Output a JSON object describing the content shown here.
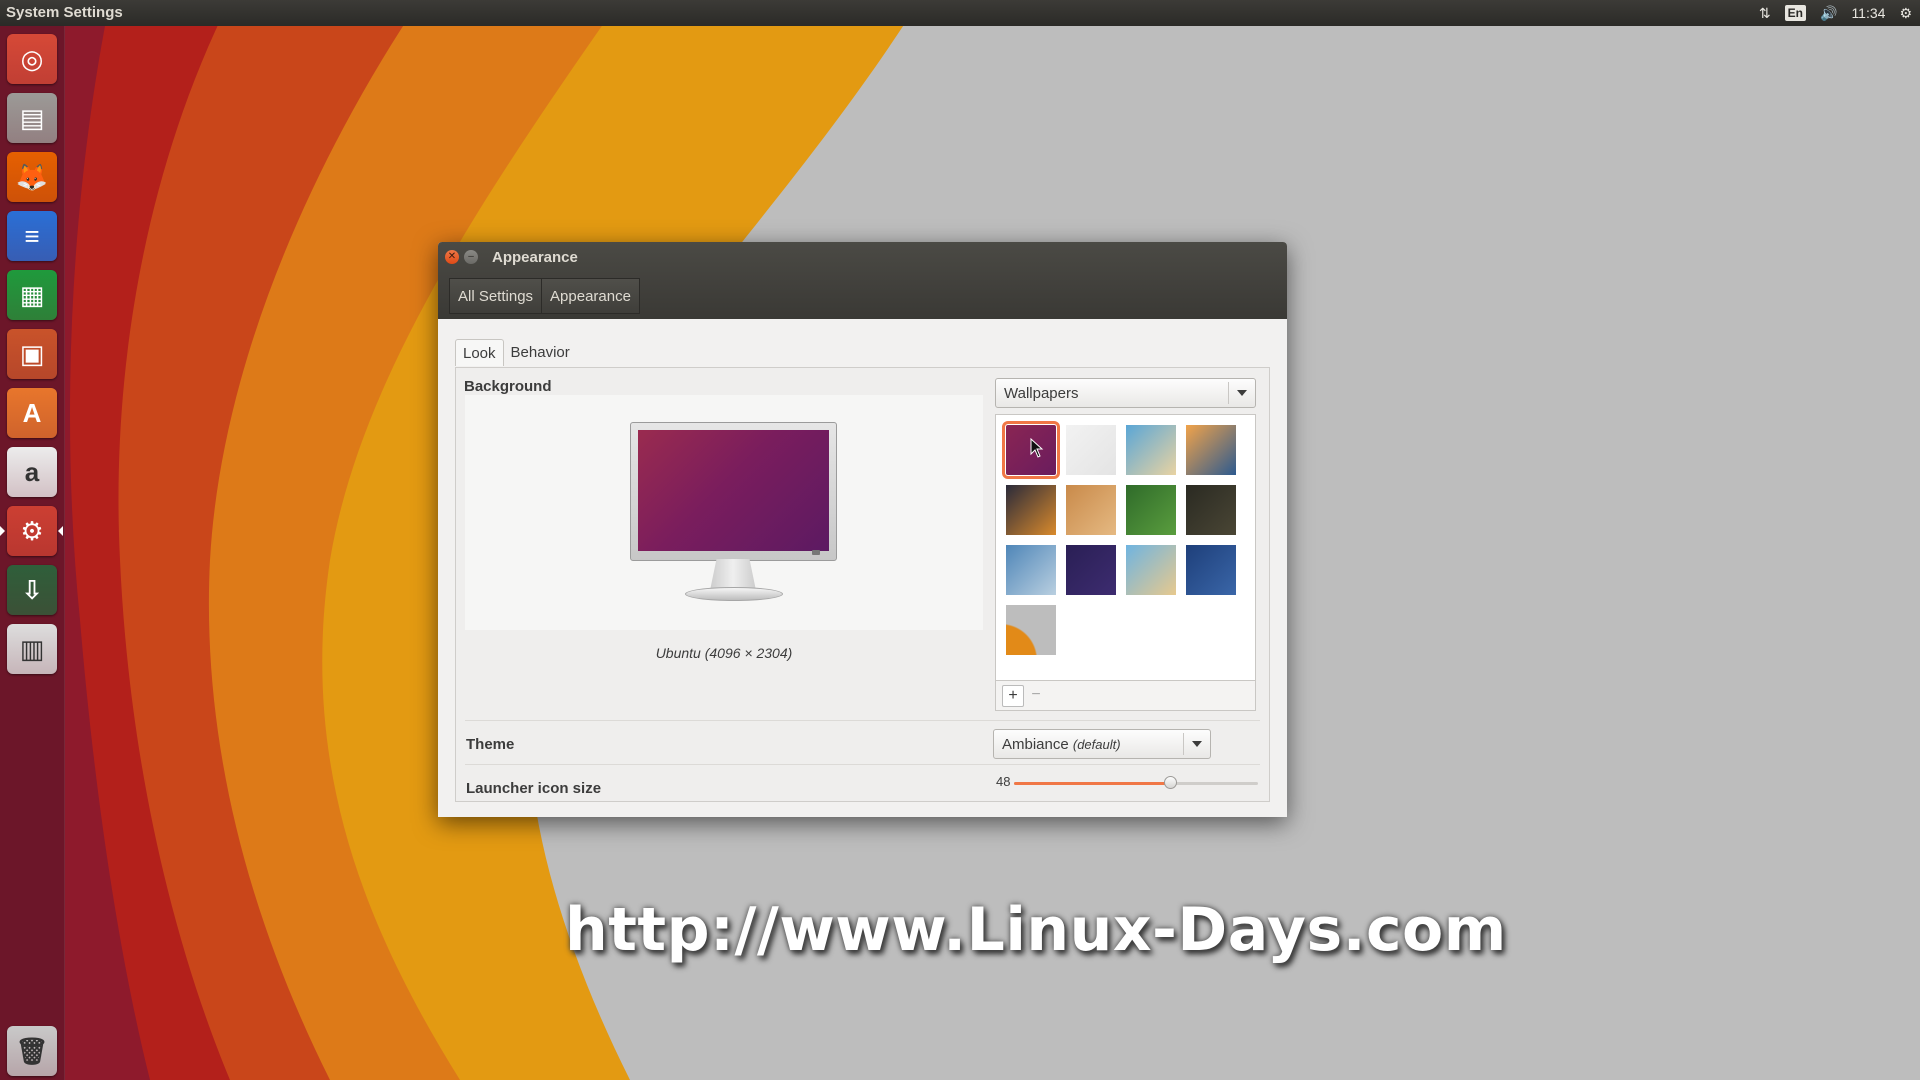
{
  "top_panel": {
    "app_title": "System Settings",
    "language": "En",
    "time": "11:34"
  },
  "launcher": {
    "items": [
      {
        "name": "Ubuntu Dash",
        "icon": "ubuntu-dash-icon",
        "color": "#d64937"
      },
      {
        "name": "Files",
        "icon": "files-icon",
        "color": "#9c9a97"
      },
      {
        "name": "Firefox",
        "icon": "firefox-icon",
        "color": "#e66000"
      },
      {
        "name": "LibreOffice Writer",
        "icon": "writer-icon",
        "color": "#2a6fd6"
      },
      {
        "name": "LibreOffice Calc",
        "icon": "calc-icon",
        "color": "#1f9a3c"
      },
      {
        "name": "LibreOffice Impress",
        "icon": "impress-icon",
        "color": "#c9532a"
      },
      {
        "name": "Ubuntu Software Center",
        "icon": "software-center-icon",
        "color": "#e8762c"
      },
      {
        "name": "Amazon",
        "icon": "amazon-icon",
        "color": "#ececec"
      },
      {
        "name": "System Settings",
        "icon": "system-settings-icon",
        "color": "#cc3f32"
      },
      {
        "name": "Terminal Installer",
        "icon": "installer-icon",
        "color": "#2f5f3a"
      },
      {
        "name": "Save",
        "icon": "floppy-icon",
        "color": "#dddddd"
      },
      {
        "name": "Trash",
        "icon": "trash-icon",
        "color": "#c9c9c9"
      }
    ]
  },
  "window": {
    "title": "Appearance",
    "breadcrumb": [
      "All Settings",
      "Appearance"
    ],
    "tabs": [
      "Look",
      "Behavior"
    ],
    "active_tab": "Look",
    "background_label": "Background",
    "wallpaper_caption": "Ubuntu (4096 × 2304)",
    "wallpaper_source": "Wallpapers",
    "theme_label": "Theme",
    "theme_value": "Ambiance",
    "theme_suffix": "(default)",
    "launcher_size_label": "Launcher icon size",
    "launcher_size_value": "48",
    "launcher_size_fraction": 0.64,
    "add_button": "+",
    "remove_button": "−",
    "thumbnails": [
      {
        "name": "purple",
        "colors": [
          "#8a2553",
          "#6a1c5e"
        ],
        "selected": true
      },
      {
        "name": "light-gray",
        "colors": [
          "#f2f2f2",
          "#e4e4e4"
        ],
        "selected": false
      },
      {
        "name": "building-sky",
        "colors": [
          "#5aa6d6",
          "#e9d3a2"
        ],
        "selected": false
      },
      {
        "name": "sunset-water",
        "colors": [
          "#f1a34a",
          "#2d5a8f"
        ],
        "selected": false
      },
      {
        "name": "flower",
        "colors": [
          "#2a2a3a",
          "#d98a2c"
        ],
        "selected": false
      },
      {
        "name": "grass",
        "colors": [
          "#c98a4a",
          "#e5b982"
        ],
        "selected": false
      },
      {
        "name": "leaves",
        "colors": [
          "#2f6b2a",
          "#5a9d3e"
        ],
        "selected": false
      },
      {
        "name": "dark-plant",
        "colors": [
          "#2a2a22",
          "#4a4635"
        ],
        "selected": false
      },
      {
        "name": "palms",
        "colors": [
          "#4f86b8",
          "#b9cfe0"
        ],
        "selected": false
      },
      {
        "name": "dark-blue",
        "colors": [
          "#2a1f55",
          "#3d2c70"
        ],
        "selected": false
      },
      {
        "name": "tower",
        "colors": [
          "#6fb4e0",
          "#e7c98e"
        ],
        "selected": false
      },
      {
        "name": "blue-water",
        "colors": [
          "#1e3f7a",
          "#3a66a8"
        ],
        "selected": false
      },
      {
        "name": "ubuntu-orange",
        "colors": [
          "#e28a18",
          "#bdbdbd"
        ],
        "selected": false
      }
    ]
  },
  "watermark": "http://www.Linux-Days.com",
  "colors": {
    "accent": "#f07746",
    "panel": "#3c3b37",
    "window_bg": "#f2f1f0"
  }
}
